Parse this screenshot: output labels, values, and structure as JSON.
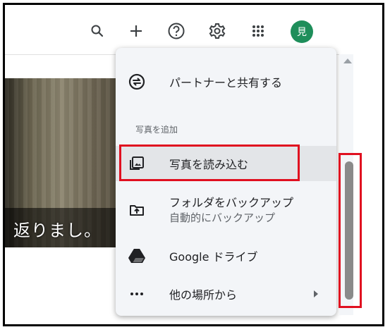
{
  "topbar": {
    "avatar_initial": "見",
    "icons": [
      "search-icon",
      "add-icon",
      "help-icon",
      "settings-icon",
      "apps-icon"
    ]
  },
  "photo": {
    "caption": "返りまし。"
  },
  "menu": {
    "share_label": "パートナーと共有する",
    "section_add_photos": "写真を追加",
    "upload_label": "写真を読み込む",
    "folder_backup_label": "フォルダをバックアップ",
    "folder_backup_sub": "自動的にバックアップ",
    "drive_label": "Google ドライブ",
    "other_label": "他の場所から"
  },
  "colors": {
    "accent_green": "#1e8e5a",
    "highlight_red": "#e01020",
    "menu_bg": "#f3f5f8",
    "selected_bg": "#e3e5e8"
  }
}
